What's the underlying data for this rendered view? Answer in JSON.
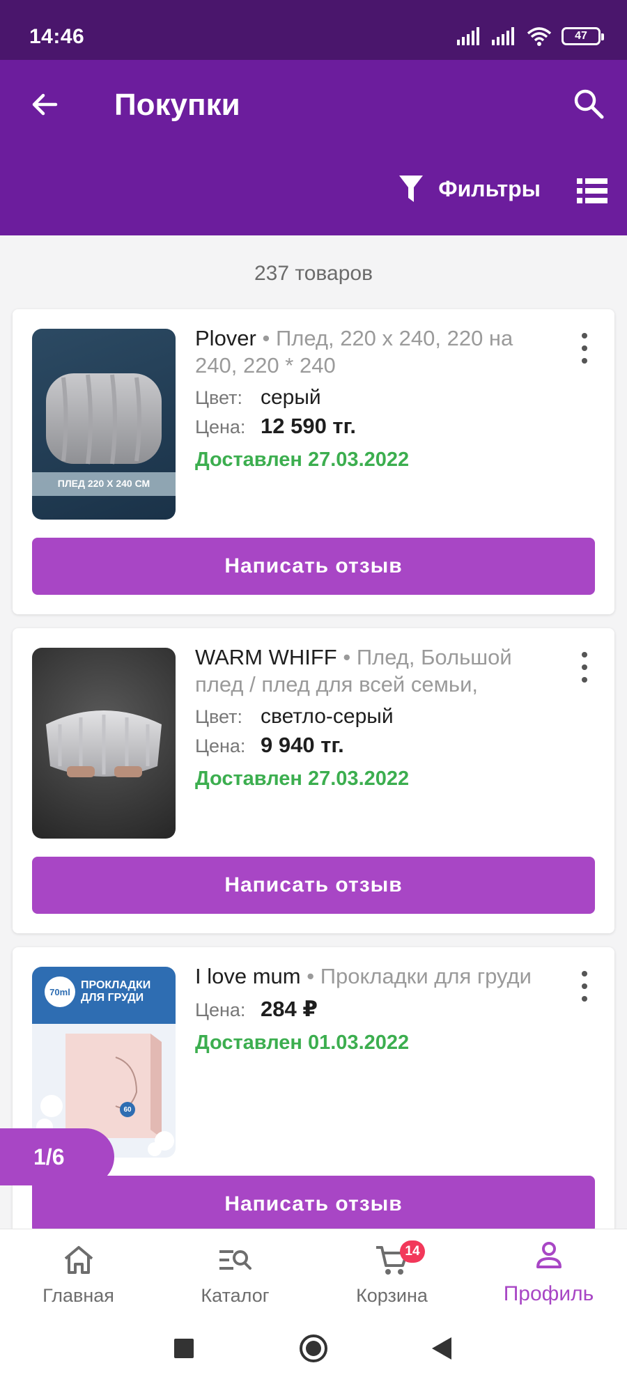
{
  "status": {
    "time": "14:46",
    "battery": "47"
  },
  "header": {
    "title": "Покупки",
    "filters_label": "Фильтры"
  },
  "list": {
    "count_label": "237 товаров"
  },
  "labels": {
    "color": "Цвет:",
    "price": "Цена:",
    "review_button": "Написать отзыв"
  },
  "items": [
    {
      "brand": "Plover",
      "name": " • Плед, 220 x 240, 220 на 240, 220 * 240",
      "color": "серый",
      "price": "12 590 тг.",
      "delivered": "Доставлен 27.03.2022",
      "image_caption": "ПЛЕД 220 Х 240 СМ"
    },
    {
      "brand": "WARM WHIFF",
      "name": " • Плед, Большой плед / плед для всей семьи,",
      "color": "светло-серый",
      "price": "9 940 тг.",
      "delivered": "Доставлен 27.03.2022"
    },
    {
      "brand": "I love mum",
      "name": " • Прокладки для груди",
      "price": "284 ₽",
      "delivered": "Доставлен 01.03.2022",
      "image_title": "ПРОКЛАДКИ ДЛЯ ГРУДИ",
      "image_badge": "70ml",
      "image_count": "60"
    }
  ],
  "pager": {
    "label": "1/6"
  },
  "bottom_nav": {
    "items": [
      {
        "label": "Главная",
        "icon": "home-icon"
      },
      {
        "label": "Каталог",
        "icon": "catalog-search-icon"
      },
      {
        "label": "Корзина",
        "icon": "cart-icon",
        "badge": "14"
      },
      {
        "label": "Профиль",
        "icon": "profile-icon",
        "active": true
      }
    ]
  },
  "colors": {
    "statusbar": "#4a166c",
    "appbar": "#6c1d9d",
    "accent": "#a846c5",
    "delivered": "#3cae4f",
    "badge": "#f2385a"
  }
}
